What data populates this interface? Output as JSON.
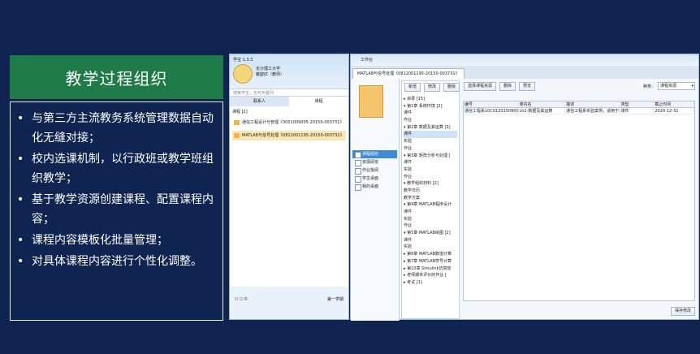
{
  "slide": {
    "title": "教学过程组织",
    "bullets": [
      "与第三方主流教务系统管理数据自动化无缝对接；",
      "校内选课机制，以行政班或教学班组织教学；",
      "基于教学资源创建课程、配置课程内容；",
      "课程内容模板化批量管理；",
      "对具体课程内容进行个性化调整。"
    ]
  },
  "im": {
    "name": "学宝 1.3.3",
    "user_line1": "长沙理工大学",
    "user_line2": "戴歆红（教师）",
    "search_placeholder": "搜索学生，也可布置列",
    "tabs": [
      "联系人",
      "课程"
    ],
    "group": "课程 [2]",
    "courses": [
      "通信工程设计与管理《3001009005-20150-003731》",
      "MATLAB与信号处理《0812001195-20150-003731》"
    ],
    "footer": "第一学期"
  },
  "wb": {
    "title": "工作台",
    "tab": "MATLAB与信号处理《0812001195-20150-003731》",
    "nav": [
      "课程组织",
      "资源阅览",
      "作业批阅",
      "学生桌面",
      "我的桌面"
    ],
    "tree_buttons": [
      "新增",
      "修改",
      "删除"
    ],
    "tree": [
      "▸ 目录 [15]",
      "  ▾ 第1章 系统环境 [2]",
      "     课件",
      "     作业",
      "  ▾ 第2章 数据及其运算 [3]",
      "     课件",
      "     实验",
      "     作业",
      "  ▾ 第3章 矩阵分析与处理 [",
      "     课件",
      "     实验",
      "     作业",
      "  ▾ 教学组织材料 [2]",
      "     教学日历",
      "     教学方案",
      "  ▾ 第4章 MATLAB程序设计",
      "     课件",
      "     实验",
      "     作业",
      "  ▾ 第5章 MATLAB绘图 [2]",
      "     课件",
      "     实验",
      "  ▸ 第6章 MATLAB数值计算",
      "  ▸ 第7章 MATLAB符号计算",
      "  ▸ 第10章 Simulink仿真软",
      "  ▸ 老师期末评价的作业 [",
      "  ▸ 考试 [1]"
    ],
    "right_buttons": [
      "选择课程资源",
      "删除",
      "预览"
    ],
    "filter_label": "种类：",
    "filter_value": "课程资源",
    "columns": [
      "编号",
      "课内名",
      "描述",
      "类型",
      "截止时间"
    ],
    "rows": [
      [
        "通信工程系10C01201509001051",
        "ch2-数据及其运算",
        "通信工程系实验案例，适用于通信工程",
        "课件",
        "2020-12-31"
      ]
    ],
    "save": "保存修改"
  }
}
